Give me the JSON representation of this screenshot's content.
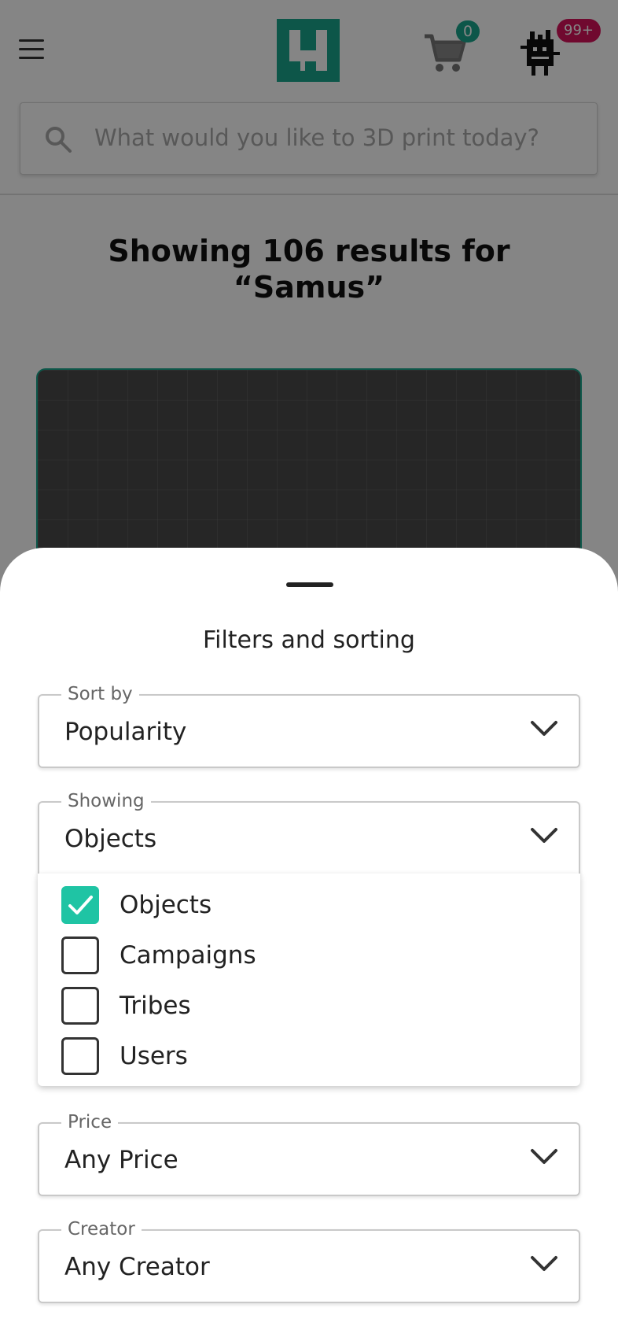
{
  "header": {
    "cart_count": "0",
    "notification_count": "99+"
  },
  "search": {
    "placeholder": "What would you like to 3D print today?"
  },
  "results": {
    "title_line1": "Showing 106 results for",
    "title_line2": "“Samus”"
  },
  "sheet": {
    "title": "Filters and sorting",
    "sort_by": {
      "label": "Sort by",
      "value": "Popularity"
    },
    "showing": {
      "label": "Showing",
      "value": "Objects",
      "options": [
        {
          "label": "Objects",
          "checked": true
        },
        {
          "label": "Campaigns",
          "checked": false
        },
        {
          "label": "Tribes",
          "checked": false
        },
        {
          "label": "Users",
          "checked": false
        }
      ]
    },
    "price": {
      "label": "Price",
      "value": "Any Price"
    },
    "creator": {
      "label": "Creator",
      "value": "Any Creator"
    }
  },
  "colors": {
    "brand": "#1aa68c",
    "checkbox_checked": "#1fc4a4",
    "notification": "#d6125a"
  },
  "icons": {
    "menu": "menu-icon",
    "cart": "cart-icon",
    "search": "search-icon",
    "chevron": "chevron-down-icon",
    "check": "check-icon"
  }
}
